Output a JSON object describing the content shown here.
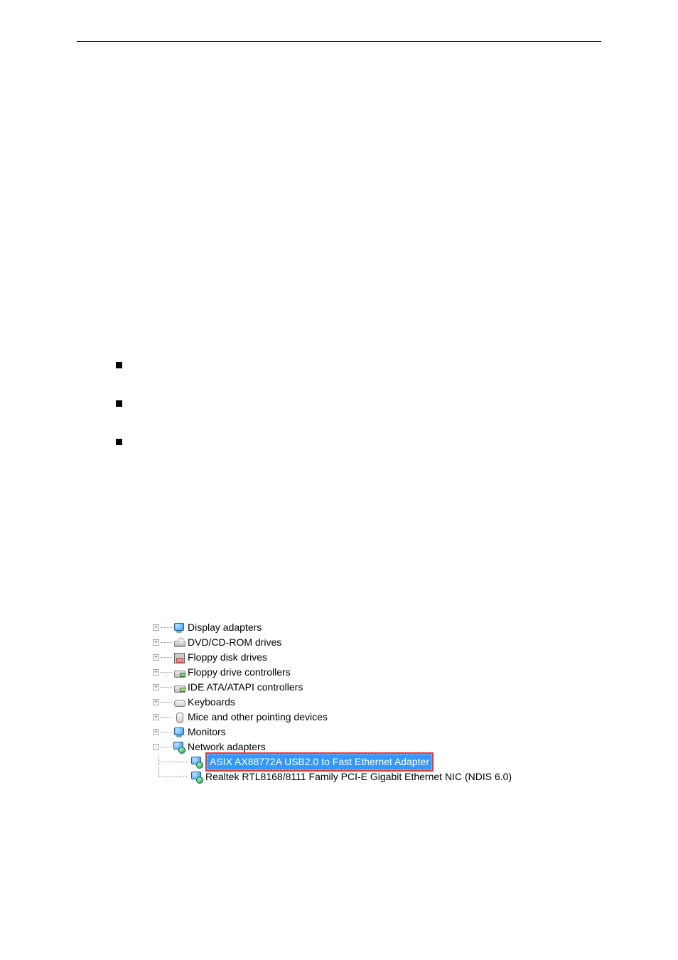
{
  "bullets_count": 3,
  "tree": {
    "display_adapters": {
      "label": "Display adapters",
      "exp": "+"
    },
    "dvd": {
      "label": "DVD/CD-ROM drives",
      "exp": "+"
    },
    "floppy_disk": {
      "label": "Floppy disk drives",
      "exp": "+"
    },
    "floppy_ctrl": {
      "label": "Floppy drive controllers",
      "exp": "+"
    },
    "ide": {
      "label": "IDE ATA/ATAPI controllers",
      "exp": "+"
    },
    "keyboards": {
      "label": "Keyboards",
      "exp": "+"
    },
    "mice": {
      "label": "Mice and other pointing devices",
      "exp": "+"
    },
    "monitors": {
      "label": "Monitors",
      "exp": "+"
    },
    "network": {
      "label": "Network adapters",
      "exp": "-",
      "children": {
        "asix": "ASIX AX88772A USB2.0 to Fast Ethernet Adapter",
        "realtek": "Realtek RTL8168/8111 Family PCI-E Gigabit Ethernet NIC (NDIS 6.0)"
      }
    }
  }
}
